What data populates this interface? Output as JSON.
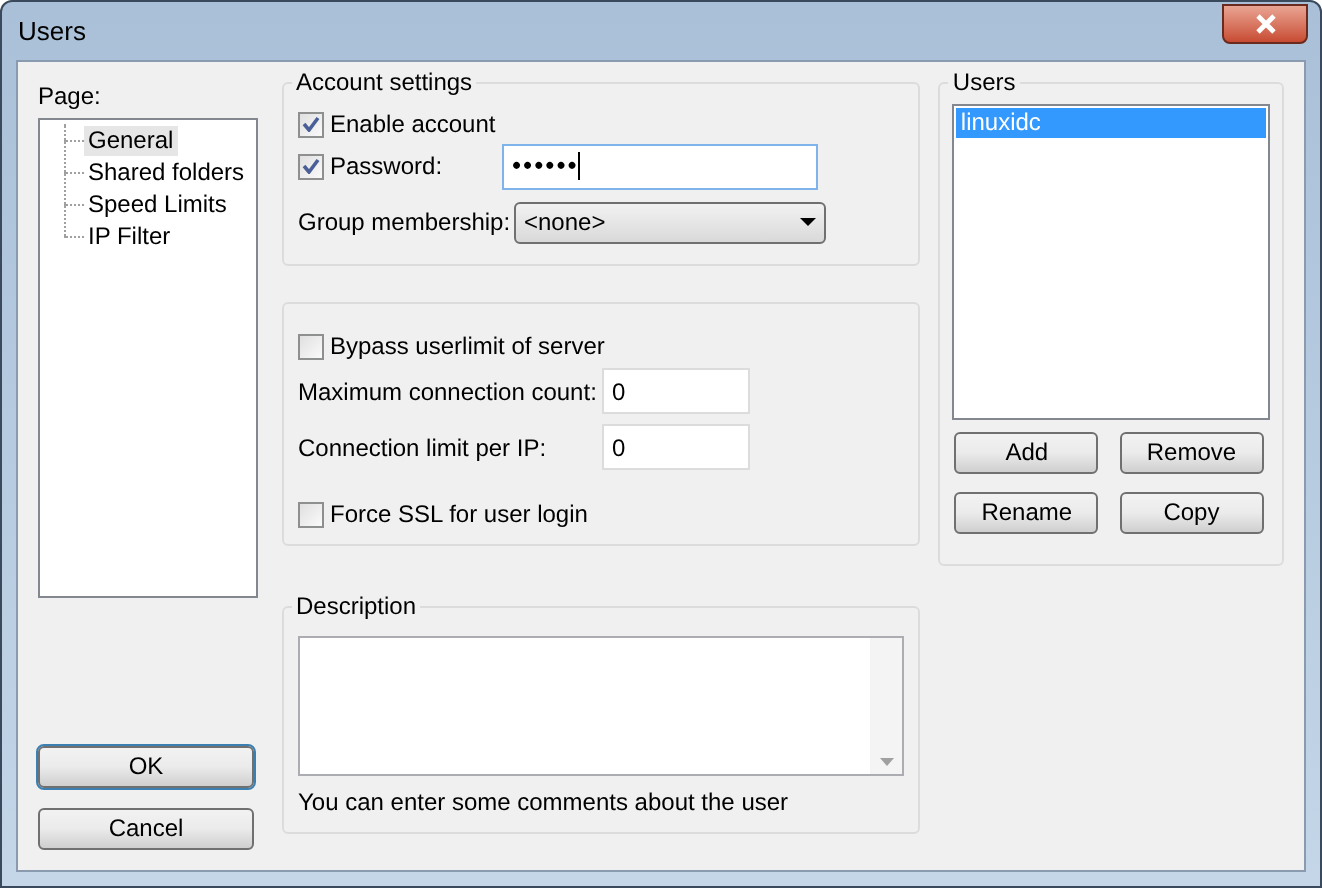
{
  "window": {
    "title": "Users"
  },
  "page_panel": {
    "label": "Page:",
    "items": [
      {
        "label": "General",
        "selected": true
      },
      {
        "label": "Shared folders",
        "selected": false
      },
      {
        "label": "Speed Limits",
        "selected": false
      },
      {
        "label": "IP Filter",
        "selected": false
      }
    ]
  },
  "account_settings": {
    "title": "Account settings",
    "enable_account": {
      "label": "Enable account",
      "checked": true
    },
    "password": {
      "label": "Password:",
      "checked": true,
      "value": "••••••"
    },
    "group_membership": {
      "label": "Group membership:",
      "value": "<none>"
    }
  },
  "limits": {
    "bypass_userlimit": {
      "label": "Bypass userlimit of server",
      "checked": false
    },
    "max_connection_count": {
      "label": "Maximum connection count:",
      "value": "0"
    },
    "connection_limit_per_ip": {
      "label": "Connection limit per IP:",
      "value": "0"
    },
    "force_ssl": {
      "label": "Force SSL for user login",
      "checked": false
    }
  },
  "description": {
    "title": "Description",
    "hint": "You can enter some comments about the user"
  },
  "users": {
    "title": "Users",
    "items": [
      {
        "label": "linuxidc",
        "selected": true
      }
    ],
    "buttons": [
      "Add",
      "Remove",
      "Rename",
      "Copy"
    ]
  },
  "buttons": [
    "OK",
    "Cancel"
  ]
}
